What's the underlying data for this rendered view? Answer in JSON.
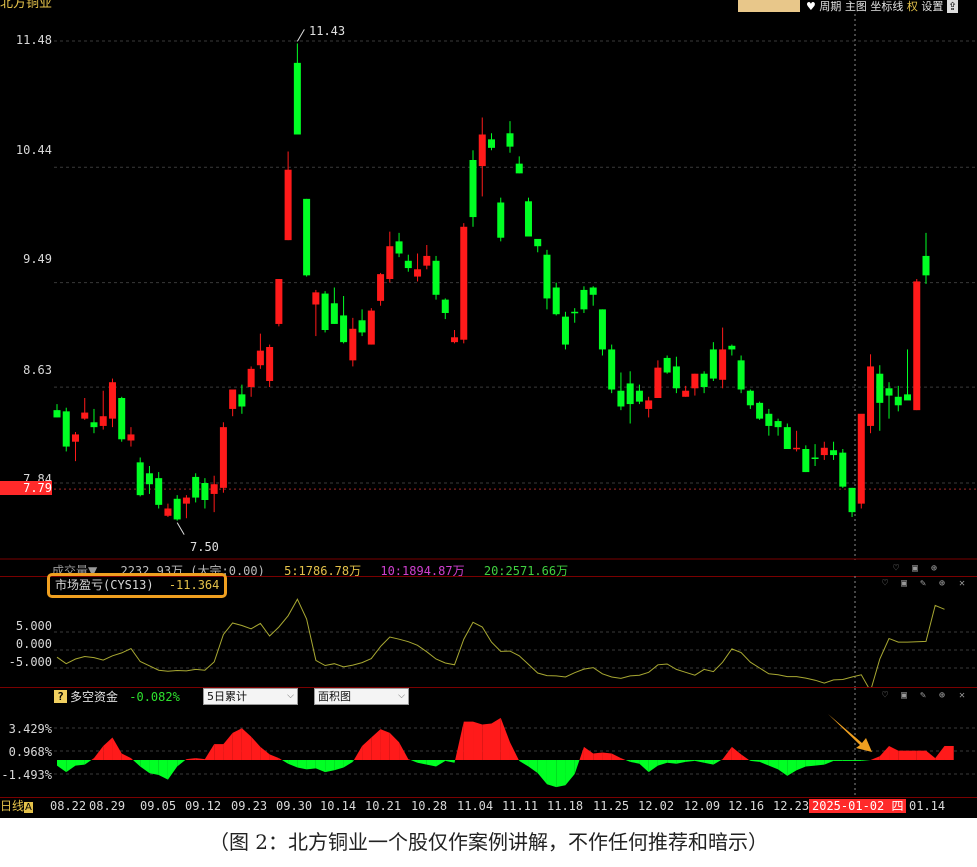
{
  "header": {
    "stock_name": "北方铜业",
    "menu": [
      {
        "id": "fav",
        "label": "♥"
      },
      {
        "id": "period",
        "label": "周期"
      },
      {
        "id": "main",
        "label": "主图"
      },
      {
        "id": "coord",
        "label": "坐标线"
      },
      {
        "id": "rights",
        "label": "权"
      },
      {
        "id": "settings",
        "label": "设置"
      },
      {
        "id": "export",
        "label": "⇪"
      }
    ]
  },
  "main_chart": {
    "y_ticks": [
      "11.48",
      "10.44",
      "9.49",
      "8.63",
      "7.84"
    ],
    "current_price": "7.79",
    "high_label": "11.43",
    "low_label": "7.50"
  },
  "volume_bar": {
    "label": "成交量▼",
    "value": "2232.93万",
    "extra": "(大宗:0.00)",
    "ma5": "5:1786.78万",
    "ma10": "10:1894.87万",
    "ma20": "20:2571.66万"
  },
  "cys_panel": {
    "label": "市场盈亏(CYS13)",
    "value": "-11.364",
    "y_ticks": [
      "5.000",
      "0.000",
      "-5.000"
    ]
  },
  "dk_panel": {
    "help": "?",
    "label": "多空资金",
    "value": "-0.082%",
    "period_select": "5日累计",
    "chart_select": "面积图",
    "y_ticks": [
      "3.429%",
      "0.968%",
      "-1.493%"
    ]
  },
  "x_axis": {
    "period_label": "日线",
    "period_badge": "A",
    "dates": [
      "08.22",
      "08.29",
      "09.05",
      "09.12",
      "09.23",
      "09.30",
      "10.14",
      "10.21",
      "10.28",
      "11.04",
      "11.11",
      "11.18",
      "11.25",
      "12.02",
      "12.09",
      "12.16",
      "12.23",
      "01.14"
    ],
    "cursor_date": "2025-01-02 四"
  },
  "caption": "（图 2：北方铜业一个股仅作案例讲解，不作任何推荐和暗示）",
  "colors": {
    "up": "#ff1a1a",
    "down": "#00ff24",
    "cys_line": "#a8a832",
    "highlight": "#f0a020",
    "accent": "#ff2a2a"
  },
  "chart_data": {
    "type": "candlestick",
    "ylim": [
      7.3,
      11.7
    ],
    "candles": [
      {
        "o": 8.44,
        "h": 8.49,
        "l": 8.38,
        "c": 8.38
      },
      {
        "o": 8.43,
        "h": 8.46,
        "l": 8.1,
        "c": 8.14
      },
      {
        "o": 8.18,
        "h": 8.26,
        "l": 8.02,
        "c": 8.24
      },
      {
        "o": 8.37,
        "h": 8.54,
        "l": 8.36,
        "c": 8.42
      },
      {
        "o": 8.34,
        "h": 8.45,
        "l": 8.25,
        "c": 8.3
      },
      {
        "o": 8.31,
        "h": 8.6,
        "l": 8.28,
        "c": 8.39
      },
      {
        "o": 8.37,
        "h": 8.7,
        "l": 8.3,
        "c": 8.67
      },
      {
        "o": 8.54,
        "h": 8.55,
        "l": 8.18,
        "c": 8.2
      },
      {
        "o": 8.19,
        "h": 8.3,
        "l": 8.14,
        "c": 8.24
      },
      {
        "o": 8.01,
        "h": 8.05,
        "l": 7.73,
        "c": 7.74
      },
      {
        "o": 7.92,
        "h": 7.98,
        "l": 7.75,
        "c": 7.83
      },
      {
        "o": 7.88,
        "h": 7.93,
        "l": 7.63,
        "c": 7.66
      },
      {
        "o": 7.57,
        "h": 7.67,
        "l": 7.56,
        "c": 7.63
      },
      {
        "o": 7.71,
        "h": 7.74,
        "l": 7.53,
        "c": 7.54
      },
      {
        "o": 7.67,
        "h": 7.74,
        "l": 7.55,
        "c": 7.72
      },
      {
        "o": 7.89,
        "h": 7.92,
        "l": 7.68,
        "c": 7.72
      },
      {
        "o": 7.84,
        "h": 7.88,
        "l": 7.63,
        "c": 7.7
      },
      {
        "o": 7.75,
        "h": 7.9,
        "l": 7.6,
        "c": 7.83
      },
      {
        "o": 7.8,
        "h": 8.34,
        "l": 7.76,
        "c": 8.3
      },
      {
        "o": 8.45,
        "h": 8.61,
        "l": 8.39,
        "c": 8.61
      },
      {
        "o": 8.57,
        "h": 8.65,
        "l": 8.41,
        "c": 8.47
      },
      {
        "o": 8.63,
        "h": 8.8,
        "l": 8.55,
        "c": 8.78
      },
      {
        "o": 8.81,
        "h": 9.07,
        "l": 8.78,
        "c": 8.93
      },
      {
        "o": 8.68,
        "h": 8.98,
        "l": 8.63,
        "c": 8.96
      },
      {
        "o": 9.15,
        "h": 9.52,
        "l": 9.13,
        "c": 9.52
      },
      {
        "o": 9.84,
        "h": 10.57,
        "l": 9.84,
        "c": 10.42
      },
      {
        "o": 11.3,
        "h": 11.46,
        "l": 10.71,
        "c": 10.71
      },
      {
        "o": 10.18,
        "h": 10.18,
        "l": 9.54,
        "c": 9.55
      },
      {
        "o": 9.31,
        "h": 9.43,
        "l": 9.05,
        "c": 9.41
      },
      {
        "o": 9.4,
        "h": 9.42,
        "l": 9.08,
        "c": 9.1
      },
      {
        "o": 9.32,
        "h": 9.45,
        "l": 9.15,
        "c": 9.15
      },
      {
        "o": 9.22,
        "h": 9.38,
        "l": 8.99,
        "c": 9.0
      },
      {
        "o": 8.85,
        "h": 9.2,
        "l": 8.8,
        "c": 9.11
      },
      {
        "o": 9.18,
        "h": 9.27,
        "l": 9.05,
        "c": 9.08
      },
      {
        "o": 8.98,
        "h": 9.28,
        "l": 8.98,
        "c": 9.26
      },
      {
        "o": 9.34,
        "h": 9.57,
        "l": 9.3,
        "c": 9.56
      },
      {
        "o": 9.52,
        "h": 9.91,
        "l": 9.49,
        "c": 9.79
      },
      {
        "o": 9.83,
        "h": 9.9,
        "l": 9.7,
        "c": 9.73
      },
      {
        "o": 9.67,
        "h": 9.72,
        "l": 9.58,
        "c": 9.61
      },
      {
        "o": 9.54,
        "h": 9.73,
        "l": 9.5,
        "c": 9.6
      },
      {
        "o": 9.63,
        "h": 9.8,
        "l": 9.6,
        "c": 9.71
      },
      {
        "o": 9.67,
        "h": 9.71,
        "l": 9.35,
        "c": 9.39
      },
      {
        "o": 9.35,
        "h": 9.36,
        "l": 9.19,
        "c": 9.24
      },
      {
        "o": 9.0,
        "h": 9.1,
        "l": 8.99,
        "c": 9.04
      },
      {
        "o": 9.02,
        "h": 9.98,
        "l": 8.99,
        "c": 9.95
      },
      {
        "o": 10.5,
        "h": 10.58,
        "l": 9.95,
        "c": 10.03
      },
      {
        "o": 10.45,
        "h": 10.85,
        "l": 10.2,
        "c": 10.71
      },
      {
        "o": 10.67,
        "h": 10.72,
        "l": 10.58,
        "c": 10.6
      },
      {
        "o": 10.15,
        "h": 10.19,
        "l": 9.83,
        "c": 9.86
      },
      {
        "o": 10.72,
        "h": 10.82,
        "l": 10.56,
        "c": 10.61
      },
      {
        "o": 10.47,
        "h": 10.53,
        "l": 10.39,
        "c": 10.39
      },
      {
        "o": 10.16,
        "h": 10.19,
        "l": 9.87,
        "c": 9.87
      },
      {
        "o": 9.85,
        "h": 9.83,
        "l": 9.74,
        "c": 9.79
      },
      {
        "o": 9.72,
        "h": 9.76,
        "l": 9.27,
        "c": 9.36
      },
      {
        "o": 9.45,
        "h": 9.49,
        "l": 9.22,
        "c": 9.23
      },
      {
        "o": 9.21,
        "h": 9.25,
        "l": 8.94,
        "c": 8.98
      },
      {
        "o": 9.25,
        "h": 9.28,
        "l": 9.16,
        "c": 9.24
      },
      {
        "o": 9.43,
        "h": 9.46,
        "l": 9.24,
        "c": 9.27
      },
      {
        "o": 9.45,
        "h": 9.46,
        "l": 9.3,
        "c": 9.39
      },
      {
        "o": 9.27,
        "h": 9.27,
        "l": 8.89,
        "c": 8.94
      },
      {
        "o": 8.94,
        "h": 8.98,
        "l": 8.58,
        "c": 8.61
      },
      {
        "o": 8.6,
        "h": 8.75,
        "l": 8.44,
        "c": 8.47
      },
      {
        "o": 8.66,
        "h": 8.76,
        "l": 8.33,
        "c": 8.49
      },
      {
        "o": 8.6,
        "h": 8.65,
        "l": 8.49,
        "c": 8.51
      },
      {
        "o": 8.45,
        "h": 8.55,
        "l": 8.38,
        "c": 8.52
      },
      {
        "o": 8.54,
        "h": 8.85,
        "l": 8.54,
        "c": 8.79
      },
      {
        "o": 8.87,
        "h": 8.89,
        "l": 8.74,
        "c": 8.75
      },
      {
        "o": 8.8,
        "h": 8.88,
        "l": 8.58,
        "c": 8.62
      },
      {
        "o": 8.55,
        "h": 8.64,
        "l": 8.55,
        "c": 8.6
      },
      {
        "o": 8.62,
        "h": 8.74,
        "l": 8.56,
        "c": 8.74
      },
      {
        "o": 8.74,
        "h": 8.76,
        "l": 8.58,
        "c": 8.63
      },
      {
        "o": 8.94,
        "h": 9.0,
        "l": 8.68,
        "c": 8.7
      },
      {
        "o": 8.69,
        "h": 9.12,
        "l": 8.62,
        "c": 8.94
      },
      {
        "o": 8.97,
        "h": 8.98,
        "l": 8.89,
        "c": 8.94
      },
      {
        "o": 8.85,
        "h": 8.89,
        "l": 8.58,
        "c": 8.61
      },
      {
        "o": 8.6,
        "h": 8.61,
        "l": 8.45,
        "c": 8.48
      },
      {
        "o": 8.5,
        "h": 8.51,
        "l": 8.36,
        "c": 8.37
      },
      {
        "o": 8.41,
        "h": 8.45,
        "l": 8.23,
        "c": 8.31
      },
      {
        "o": 8.35,
        "h": 8.37,
        "l": 8.23,
        "c": 8.3
      },
      {
        "o": 8.3,
        "h": 8.33,
        "l": 8.13,
        "c": 8.12
      },
      {
        "o": 8.13,
        "h": 8.27,
        "l": 8.1,
        "c": 8.13
      },
      {
        "o": 8.12,
        "h": 8.15,
        "l": 7.93,
        "c": 7.93
      },
      {
        "o": 8.05,
        "h": 8.16,
        "l": 7.98,
        "c": 8.04
      },
      {
        "o": 8.07,
        "h": 8.18,
        "l": 8.03,
        "c": 8.13
      },
      {
        "o": 8.11,
        "h": 8.18,
        "l": 8.03,
        "c": 8.07
      },
      {
        "o": 8.09,
        "h": 8.12,
        "l": 7.8,
        "c": 7.81
      },
      {
        "o": 7.8,
        "h": 7.8,
        "l": 7.56,
        "c": 7.6
      },
      {
        "o": 7.67,
        "h": 8.38,
        "l": 7.63,
        "c": 8.41
      },
      {
        "o": 8.31,
        "h": 8.9,
        "l": 8.25,
        "c": 8.8
      },
      {
        "o": 8.74,
        "h": 8.81,
        "l": 8.27,
        "c": 8.5
      },
      {
        "o": 8.62,
        "h": 8.67,
        "l": 8.37,
        "c": 8.56
      },
      {
        "o": 8.55,
        "h": 8.64,
        "l": 8.43,
        "c": 8.48
      },
      {
        "o": 8.57,
        "h": 8.94,
        "l": 8.55,
        "c": 8.52
      },
      {
        "o": 8.44,
        "h": 9.52,
        "l": 8.44,
        "c": 9.5
      },
      {
        "o": 9.71,
        "h": 9.9,
        "l": 9.48,
        "c": 9.55
      }
    ],
    "cys_values": [
      -2,
      -3.8,
      -2.5,
      -1.8,
      -2.1,
      -2.8,
      -1.6,
      -0.8,
      0.4,
      -3.2,
      -4.4,
      -5.6,
      -5.9,
      -5.7,
      -5.8,
      -5.4,
      -5.6,
      -3.3,
      4.3,
      7.5,
      6.8,
      5.9,
      7.4,
      3.9,
      6.4,
      9.5,
      14.1,
      8.6,
      -2.9,
      -4.3,
      -3.8,
      -4.7,
      -4.2,
      -3.5,
      -2.4,
      1.0,
      3.6,
      3.0,
      2.3,
      1.3,
      -0.5,
      -2.5,
      -3.6,
      -4.1,
      3.0,
      7.7,
      6.4,
      2.2,
      -0.4,
      -0.3,
      -1.6,
      -4.0,
      -6.4,
      -7.1,
      -7.2,
      -7.5,
      -6.3,
      -5.3,
      -4.9,
      -6.6,
      -7.5,
      -7.9,
      -7.2,
      -7.0,
      -6.2,
      -4.1,
      -3.9,
      -5.4,
      -6.2,
      -7.0,
      -5.4,
      -6.0,
      -3.4,
      0.3,
      -0.7,
      -3.4,
      -5.0,
      -6.6,
      -6.9,
      -7.4,
      -7.4,
      -7.8,
      -8.4,
      -9.2,
      -8.3,
      -8.2,
      -7.5,
      -6.9,
      -11.4,
      -2.5,
      3.2,
      2.2,
      2.2,
      2.3,
      2.4,
      12.4,
      11.3
    ],
    "dk_values": [
      -0.6,
      -1.3,
      -0.6,
      -0.5,
      0.2,
      1.5,
      2.4,
      0.7,
      0.2,
      -0.7,
      -1.4,
      -1.6,
      -2.1,
      -0.7,
      0.1,
      0.2,
      0.1,
      1.7,
      1.7,
      2.9,
      3.4,
      2.5,
      1.4,
      0.6,
      0.2,
      -0.4,
      -0.8,
      -1.0,
      -0.9,
      -1.3,
      -1.1,
      -0.8,
      -0.2,
      1.5,
      2.4,
      3.3,
      2.9,
      1.9,
      0.1,
      -0.3,
      -0.5,
      -0.7,
      -0.1,
      -0.3,
      4.1,
      4.1,
      3.8,
      3.9,
      4.5,
      1.9,
      -0.1,
      -0.7,
      -1.4,
      -2.6,
      -2.9,
      -2.7,
      -1.5,
      1.4,
      0.7,
      0.8,
      0.7,
      0.2,
      -0.2,
      -0.4,
      -1.3,
      -0.6,
      -0.3,
      -0.4,
      -0.2,
      -0.1,
      -0.3,
      -0.5,
      0.1,
      1.4,
      0.6,
      -0.1,
      -0.2,
      -0.6,
      -1.0,
      -1.7,
      -1.1,
      -0.7,
      -0.6,
      -0.5,
      -0.1,
      -0.1,
      -0.1,
      -0.1,
      0.0,
      0.4,
      1.5,
      1.0,
      1.0,
      1.0,
      1.0,
      0.2,
      1.5,
      1.5
    ],
    "dk_ylim": [
      -3.2,
      4.8
    ],
    "cys_ylim": [
      -12,
      15
    ]
  }
}
